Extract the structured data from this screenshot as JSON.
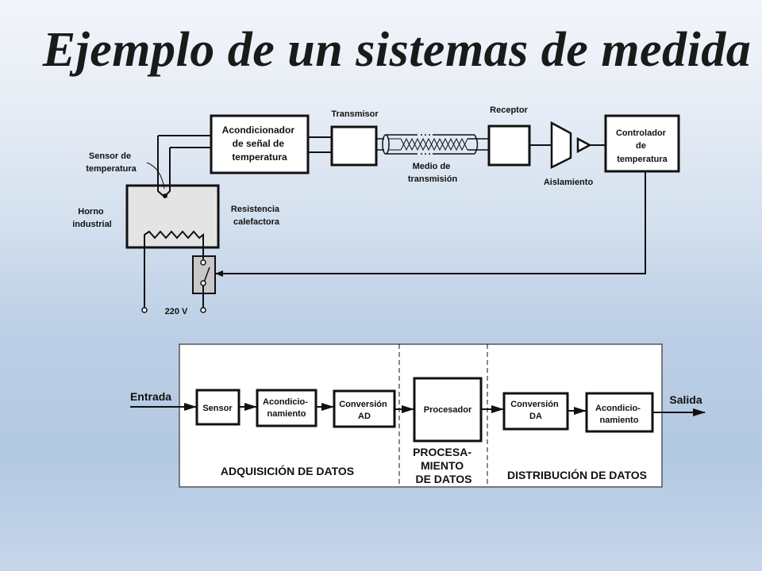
{
  "title": "Ejemplo de un sistemas de medida",
  "top_diagram": {
    "sensor_label": [
      "Sensor de",
      "temperatura"
    ],
    "horno_label": [
      "Horno",
      "industrial"
    ],
    "resistencia_label": [
      "Resistencia",
      "calefactora"
    ],
    "acondicionador_label": [
      "Acondicionador",
      "de señal de",
      "temperatura"
    ],
    "transmisor_label": "Transmisor",
    "medio_label": [
      "Medio de",
      "transmisión"
    ],
    "receptor_label": "Receptor",
    "aislamiento_label": "Aislamiento",
    "controlador_label": [
      "Controlador",
      "de",
      "temperatura"
    ],
    "voltage_label": "220 V"
  },
  "bottom_diagram": {
    "input_label": "Entrada",
    "output_label": "Salida",
    "blocks": {
      "sensor": [
        "Sensor"
      ],
      "acond1": [
        "Acondicio-",
        "namiento"
      ],
      "conv_ad": [
        "Conversión",
        "AD"
      ],
      "procesador": [
        "Procesador"
      ],
      "conv_da": [
        "Conversión",
        "DA"
      ],
      "acond2": [
        "Acondicio-",
        "namiento"
      ]
    },
    "sections": {
      "adquisicion": "ADQUISICIÓN DE DATOS",
      "procesamiento": [
        "PROCESA-",
        "MIENTO",
        "DE DATOS"
      ],
      "distribucion": "DISTRIBUCIÓN DE DATOS"
    }
  }
}
